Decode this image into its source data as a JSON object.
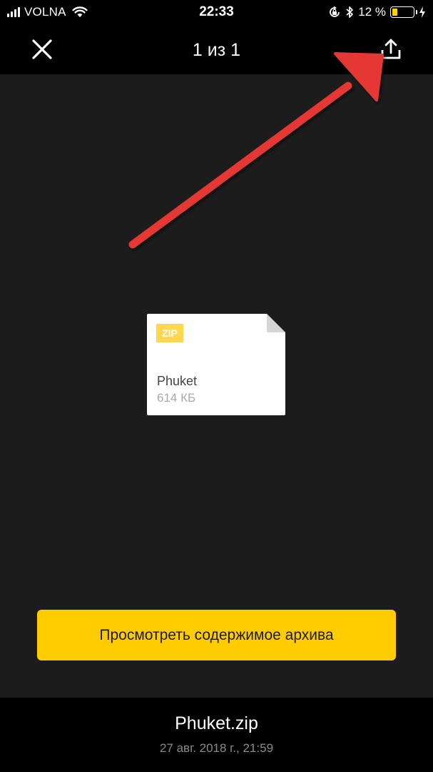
{
  "status_bar": {
    "carrier": "VOLNA",
    "time": "22:33",
    "battery_percent": "12 %",
    "battery_level": 0.12,
    "icons": [
      "signal-icon",
      "wifi-icon",
      "orientation-lock-icon",
      "bluetooth-icon",
      "battery-icon",
      "charging-icon"
    ]
  },
  "header": {
    "page_counter": "1 из 1",
    "close_icon": "close-icon",
    "share_icon": "share-icon"
  },
  "file": {
    "type_badge": "ZIP",
    "name": "Phuket",
    "size": "614 КБ"
  },
  "actions": {
    "view_archive_label": "Просмотреть содержимое архива"
  },
  "footer": {
    "file_name": "Phuket.zip",
    "date": "27 авг. 2018 г., 21:59"
  },
  "colors": {
    "accent": "#ffcc00",
    "background": "#1c1c1c",
    "bars": "#000000",
    "annotation_arrow": "#e53935"
  }
}
